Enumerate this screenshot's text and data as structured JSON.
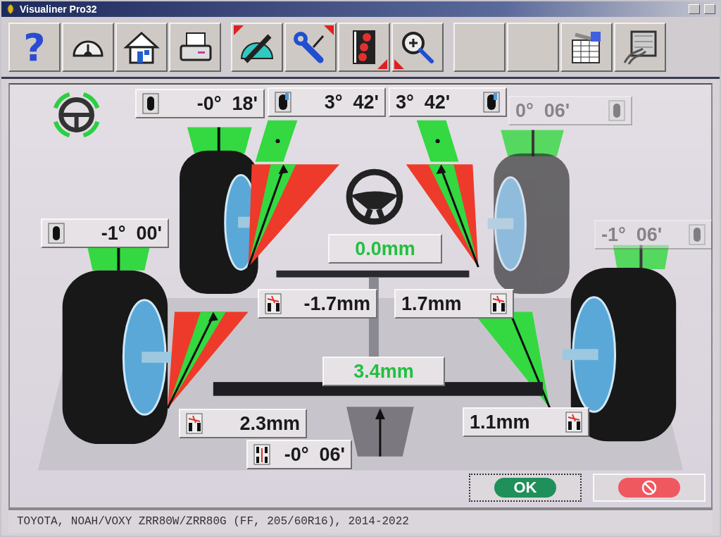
{
  "window": {
    "title": "Visualiner Pro32"
  },
  "toolbar": [
    [
      {
        "kind": "help",
        "glyph": "?",
        "corners": [
          false,
          false,
          false,
          false
        ]
      },
      {
        "kind": "gauge",
        "corners": [
          false,
          false,
          false,
          false
        ]
      },
      {
        "kind": "home",
        "corners": [
          false,
          false,
          false,
          false
        ]
      },
      {
        "kind": "print",
        "corners": [
          false,
          false,
          false,
          false
        ]
      }
    ],
    [
      {
        "kind": "measure",
        "corners": [
          true,
          false,
          false,
          false
        ]
      },
      {
        "kind": "adjust",
        "corners": [
          false,
          true,
          false,
          false
        ]
      },
      {
        "kind": "video",
        "corners": [
          false,
          false,
          true,
          false
        ]
      },
      {
        "kind": "zoom",
        "corners": [
          false,
          false,
          false,
          true
        ]
      }
    ],
    [
      {
        "kind": "blank",
        "corners": [
          false,
          false,
          false,
          false
        ]
      },
      {
        "kind": "blank",
        "corners": [
          false,
          false,
          false,
          false
        ]
      },
      {
        "kind": "report",
        "corners": [
          false,
          false,
          false,
          false
        ]
      },
      {
        "kind": "wiring",
        "corners": [
          false,
          false,
          false,
          false
        ]
      }
    ]
  ],
  "readings": [
    {
      "kind": "camber",
      "value": "-0°  18'",
      "icon_right": false,
      "dimmed": false
    },
    {
      "kind": "caster",
      "value": "3°  42'",
      "icon_right": false,
      "dimmed": false
    },
    {
      "kind": "caster",
      "value": "3°  42'",
      "icon_right": true,
      "dimmed": false
    },
    {
      "kind": "camber",
      "value": "0°  06'",
      "icon_right": true,
      "dimmed": true
    },
    {
      "kind": "camber",
      "value": "-1°  00'",
      "icon_right": false,
      "dimmed": false
    },
    {
      "kind": "camber",
      "value": "-1°  06'",
      "icon_right": true,
      "dimmed": true
    },
    {
      "kind": "total",
      "value": "0.0mm",
      "dimmed": false
    },
    {
      "kind": "toe",
      "value": "-1.7mm",
      "icon_right": false,
      "dimmed": false
    },
    {
      "kind": "toe",
      "value": "1.7mm",
      "icon_right": true,
      "dimmed": false
    },
    {
      "kind": "total",
      "value": "3.4mm",
      "dimmed": false
    },
    {
      "kind": "toe",
      "value": "2.3mm",
      "icon_right": false,
      "dimmed": false
    },
    {
      "kind": "toe",
      "value": "1.1mm",
      "icon_right": true,
      "dimmed": false
    },
    {
      "kind": "thrust",
      "value": "-0°  06'",
      "icon_right": false,
      "dimmed": false
    }
  ],
  "buttons": [
    {
      "kind": "ok",
      "label": "OK",
      "focused": true
    },
    {
      "kind": "cancel",
      "focused": false
    }
  ],
  "status_bar": "TOYOTA, NOAH/VOXY ZRR80W/ZRR80G (FF, 205/60R16), 2014-2022"
}
